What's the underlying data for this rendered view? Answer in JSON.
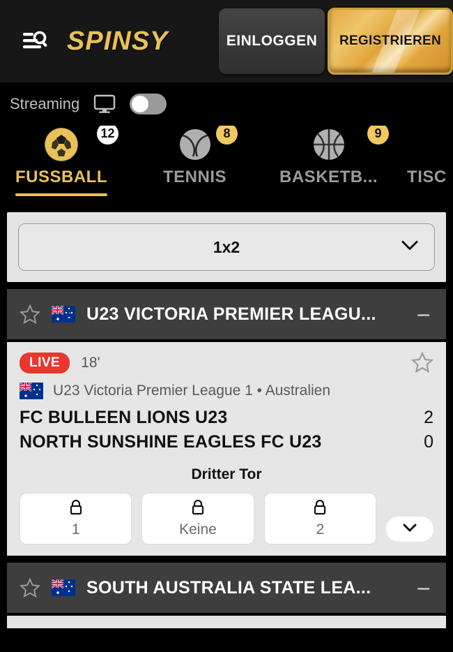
{
  "header": {
    "brand": "SPINSY",
    "menu_icon": "menu-search-icon",
    "login_label": "EINLOGGEN",
    "register_label": "REGISTRIEREN",
    "colors": {
      "brand_gold": "#E8C158",
      "register_gold": "#E0A33A",
      "bar_bg": "#171717"
    }
  },
  "streaming": {
    "label": "Streaming",
    "monitor_icon": "monitor-icon",
    "toggle_state": "off"
  },
  "tabs": [
    {
      "label": "FUSSBALL",
      "badge": "12",
      "badge_style": "white",
      "icon": "soccer-ball-icon",
      "active": true
    },
    {
      "label": "TENNIS",
      "badge": "8",
      "badge_style": "gold",
      "icon": "tennis-ball-icon",
      "active": false
    },
    {
      "label": "BASKETB...",
      "badge": "9",
      "badge_style": "gold",
      "icon": "basketball-icon",
      "active": false
    },
    {
      "label": "TISC",
      "badge": "",
      "badge_style": "none",
      "icon": "table-tennis-icon",
      "active": false
    }
  ],
  "filter": {
    "selected": "1x2",
    "chevron_icon": "chevron-down-icon"
  },
  "leagues": [
    {
      "title": "U23 VICTORIA PREMIER LEAGU...",
      "flag": "australia-flag-icon",
      "star_icon": "star-outline-icon",
      "collapse_icon": "minus-icon",
      "collapse_label": "–"
    },
    {
      "title": "SOUTH AUSTRALIA STATE LEA...",
      "flag": "australia-flag-icon",
      "star_icon": "star-outline-icon",
      "collapse_icon": "minus-icon",
      "collapse_label": "–"
    }
  ],
  "match": {
    "live_label": "LIVE",
    "minute": "18'",
    "star_icon": "star-outline-icon",
    "league_line": "U23 Victoria Premier League 1 • Australien",
    "flag": "australia-flag-icon",
    "home_team": "FC BULLEEN LIONS U23",
    "home_score": "2",
    "away_team": "NORTH SUNSHINE EAGLES FC U23",
    "away_score": "0",
    "market_title": "Dritter Tor",
    "odds": [
      {
        "label": "1",
        "locked": true,
        "icon": "lock-icon"
      },
      {
        "label": "Keine",
        "locked": true,
        "icon": "lock-icon"
      },
      {
        "label": "2",
        "locked": true,
        "icon": "lock-icon"
      }
    ],
    "expand_icon": "chevron-down-icon"
  }
}
